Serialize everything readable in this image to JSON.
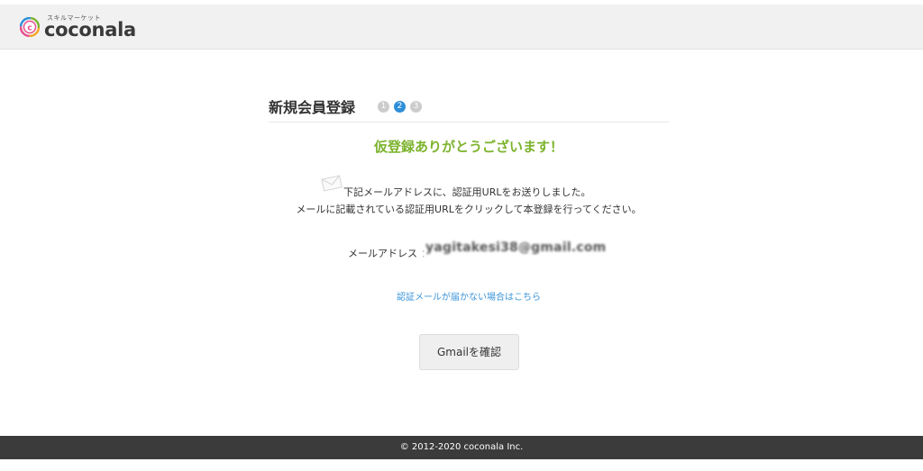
{
  "header": {
    "logo_tagline": "スキルマーケット",
    "logo_wordmark": "coconala",
    "brand_colors": [
      "#f5a623",
      "#e94b8a",
      "#2e8fd8",
      "#7cb32d"
    ]
  },
  "registration": {
    "title": "新規会員登録",
    "steps": [
      {
        "label": "1",
        "active": false
      },
      {
        "label": "2",
        "active": true
      },
      {
        "label": "3",
        "active": false
      }
    ],
    "thanks_message": "仮登録ありがとうございます！",
    "envelope_icon": "envelope-icon",
    "message_line1": "下記メールアドレスに、認証用URLをお送りしました。",
    "message_line2": "メールに記載されている認証用URLをクリックして本登録を行ってください。",
    "email_label": "メールアドレス",
    "email_separator": "：",
    "email_value": "yagitakesi38@gmail.com",
    "help_link": "認証メールが届かない場合はこちら",
    "gmail_button": "Gmailを確認"
  },
  "footer": {
    "copyright": "© 2012-2020 coconala Inc."
  },
  "colors": {
    "accent_green": "#7cb32d",
    "link_blue": "#3a94d9",
    "active_step": "#2e8fd8",
    "footer_bg": "#3b3b3b"
  }
}
